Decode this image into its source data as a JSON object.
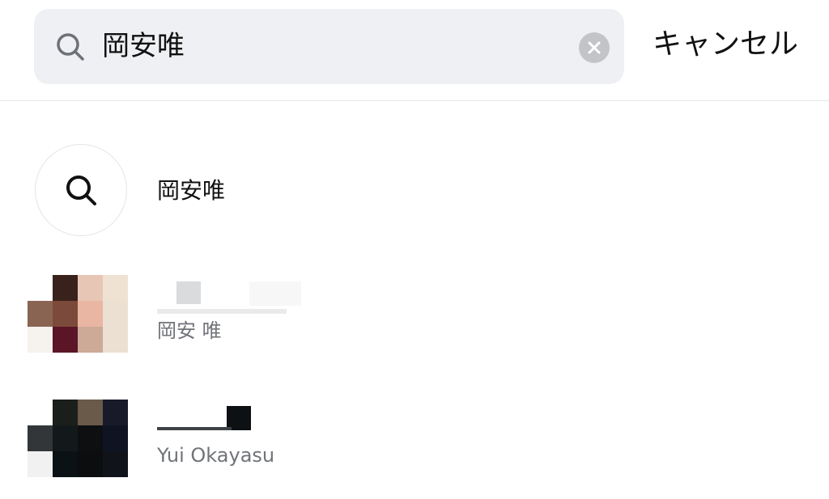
{
  "search": {
    "query": "岡安唯",
    "cancel_label": "キャンセル"
  },
  "suggestion": {
    "label": "岡安唯"
  },
  "results": [
    {
      "display_name": "",
      "subtitle": "岡安 唯"
    },
    {
      "display_name": "",
      "subtitle": "Yui Okayasu"
    }
  ],
  "colors": {
    "search_bg": "#eff0f3",
    "clear_button": "#c3c4c8",
    "subtitle_text": "#707379",
    "divider": "#e6e7ea"
  },
  "icons": {
    "search_bar": "search-icon",
    "clear": "clear-icon",
    "suggestion": "search-icon"
  }
}
